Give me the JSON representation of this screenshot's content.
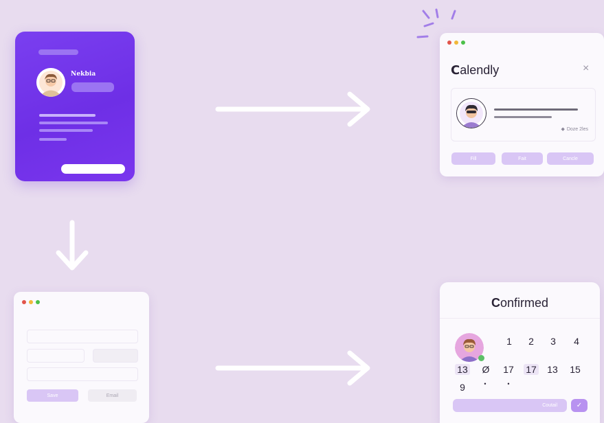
{
  "profile_card": {
    "name": "Nekbia"
  },
  "calendly_window": {
    "title_mark": "C",
    "title_rest": "alendly",
    "close": "×",
    "event_meta": "Doze 2les",
    "buttons": [
      "Fill",
      "Fait",
      "Cancle"
    ]
  },
  "form_window": {
    "buttons": [
      "Save",
      "Email"
    ]
  },
  "confirmed_window": {
    "title_mark": "C",
    "title_rest": "onfirmed",
    "calendar": {
      "row1": [
        "1",
        "2",
        "3",
        "4"
      ],
      "row2": [
        "13",
        "Ø",
        "17",
        "17",
        "13",
        "15"
      ],
      "row3": [
        "9",
        "•",
        "•"
      ]
    },
    "cta_label": "Coutail",
    "check": "✓"
  },
  "colors": {
    "background": "#e8dcef",
    "card_purple": "#7a3ff0",
    "soft_purple": "#d9c6f5",
    "dot_red": "#e2544b",
    "dot_yellow": "#f1b83a",
    "dot_green": "#4cc04a"
  },
  "icons": [
    "arrow-right-icon",
    "arrow-down-icon",
    "close-icon",
    "clock-icon",
    "check-icon",
    "sparkle-icon"
  ]
}
